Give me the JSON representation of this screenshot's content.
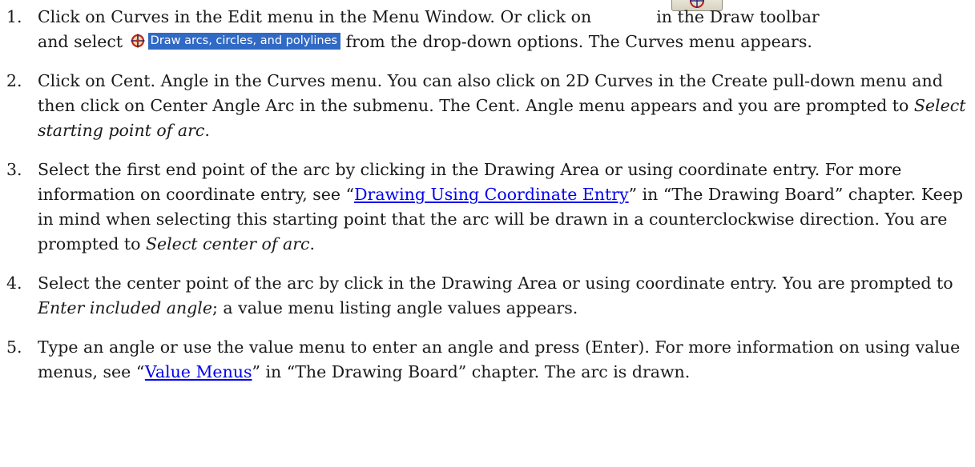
{
  "icons": {
    "draw_toolbar_button": "curves-tool-icon",
    "dropdown_option_icon": "arcs-circles-polylines-icon"
  },
  "colors": {
    "link": "#0000ee",
    "dropdown_highlight": "#316ac5"
  },
  "steps": [
    {
      "number": "1.",
      "part1": "Click on Curves in the Edit menu in the Menu Window. Or click on",
      "part2": "in the Draw toolbar",
      "part3": "and select",
      "dropdown_option": "Draw arcs, circles, and polylines",
      "part4": "from the drop-down options. The Curves menu appears."
    },
    {
      "number": "2.",
      "text": "Click on Cent. Angle in the Curves menu. You can also click on 2D Curves in the Create pull-down menu and then click on Center Angle Arc in the submenu. The Cent. Angle menu appears and you are prompted to",
      "prompt": "Select starting point of arc",
      "end": "."
    },
    {
      "number": "3.",
      "text": "Select the first end point of the arc by clicking in the Drawing Area or using coordinate entry. For more information on coordinate entry, see “",
      "link": "Drawing Using Coordinate Entry",
      "text2": "” in “The Drawing Board” chapter. Keep in mind when selecting this starting point that the arc will be drawn in a counterclockwise direction. You are prompted to",
      "prompt": "Select center of arc",
      "end": "."
    },
    {
      "number": "4.",
      "text": "Select the center point of the arc by click in the Drawing Area or using coordinate entry. You are prompted to",
      "prompt": "Enter included angle",
      "text2": "; a value menu listing angle values appears."
    },
    {
      "number": "5.",
      "text": "Type an angle or use the value menu to enter an angle and press (Enter). For more information on using value menus, see “",
      "link": "Value Menus",
      "text2": "” in “The Drawing Board” chapter. The arc is drawn."
    }
  ]
}
